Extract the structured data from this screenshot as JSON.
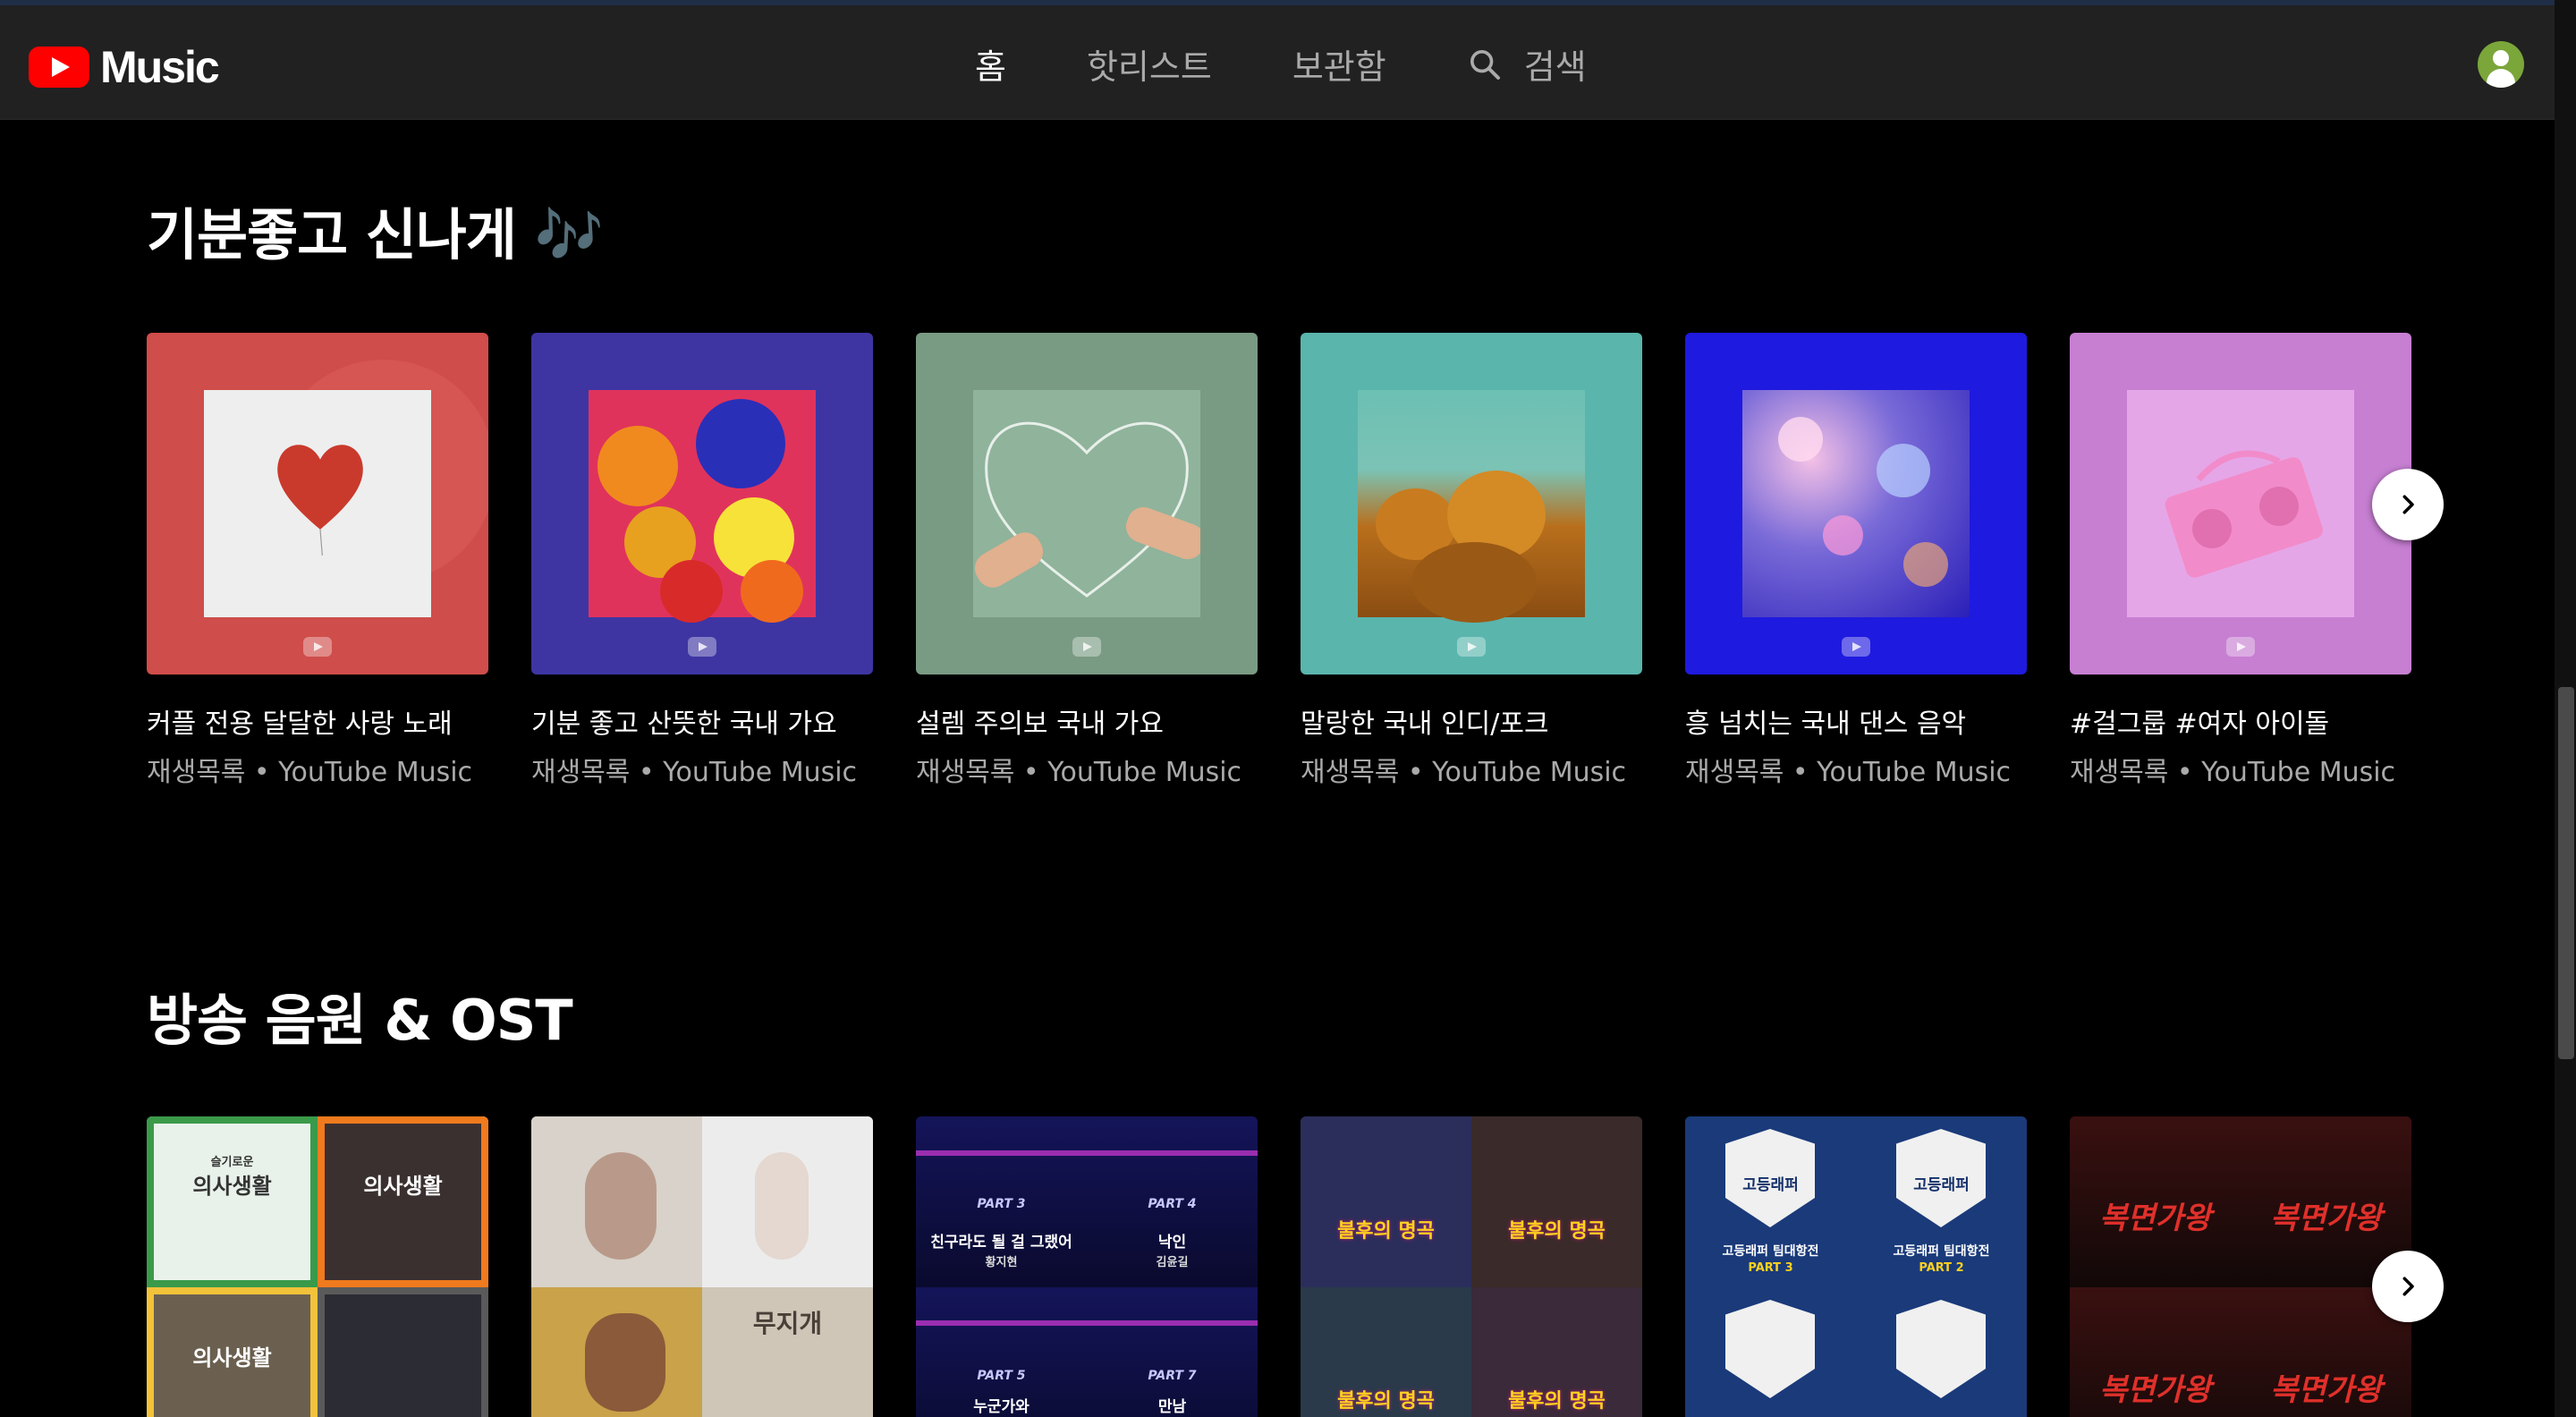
{
  "header": {
    "logo_text": "Music",
    "nav": [
      {
        "label": "홈",
        "active": true
      },
      {
        "label": "핫리스트",
        "active": false
      },
      {
        "label": "보관함",
        "active": false
      }
    ],
    "search_label": "검색"
  },
  "sections": [
    {
      "title": "기분좋고 신나게 🎶",
      "cards": [
        {
          "title": "커플 전용 달달한 사랑 노래",
          "subtitle": "재생목록 • YouTube Music"
        },
        {
          "title": "기분 좋고 산뜻한 국내 가요",
          "subtitle": "재생목록 • YouTube Music"
        },
        {
          "title": "설렘 주의보 국내 가요",
          "subtitle": "재생목록 • YouTube Music"
        },
        {
          "title": "말랑한 국내 인디/포크",
          "subtitle": "재생목록 • YouTube Music"
        },
        {
          "title": "흥 넘치는 국내 댄스 음악",
          "subtitle": "재생목록 • YouTube Music"
        },
        {
          "title": "#걸그룹 #여자 아이돌",
          "subtitle": "재생목록 • YouTube Music"
        }
      ]
    },
    {
      "title": "방송 음원 & OST",
      "cards": [
        {
          "art_texts": [
            "슬기로운",
            "의사생활",
            "의사생활",
            "의사생활"
          ]
        },
        {
          "art_texts": [
            "무지개"
          ]
        },
        {
          "art_texts": [
            "PART 3",
            "PART 4",
            "친구라도 될 걸 그랬어",
            "낙인",
            "황지현",
            "김윤길",
            "PART 5",
            "PART 7",
            "누군가와",
            "만남"
          ]
        },
        {
          "art_texts": [
            "불후의 명곡",
            "불후의 명곡",
            "불후의 명곡",
            "불후의 명곡"
          ]
        },
        {
          "art_texts": [
            "고등래퍼",
            "고등래퍼",
            "고등래퍼 팀대항전",
            "고등래퍼 팀대항전",
            "PART 3",
            "PART 2"
          ]
        },
        {
          "art_texts": [
            "복면가왕",
            "복면가왕",
            "복면가왕",
            "복면가왕"
          ]
        }
      ]
    }
  ],
  "colors": {
    "header_bg": "#212121",
    "page_bg": "#000000",
    "accent": "#ff0000",
    "secondary_text": "#aaaaaa"
  },
  "icons": [
    "youtube-play-icon",
    "search-icon",
    "account-icon",
    "chevron-right-icon"
  ]
}
